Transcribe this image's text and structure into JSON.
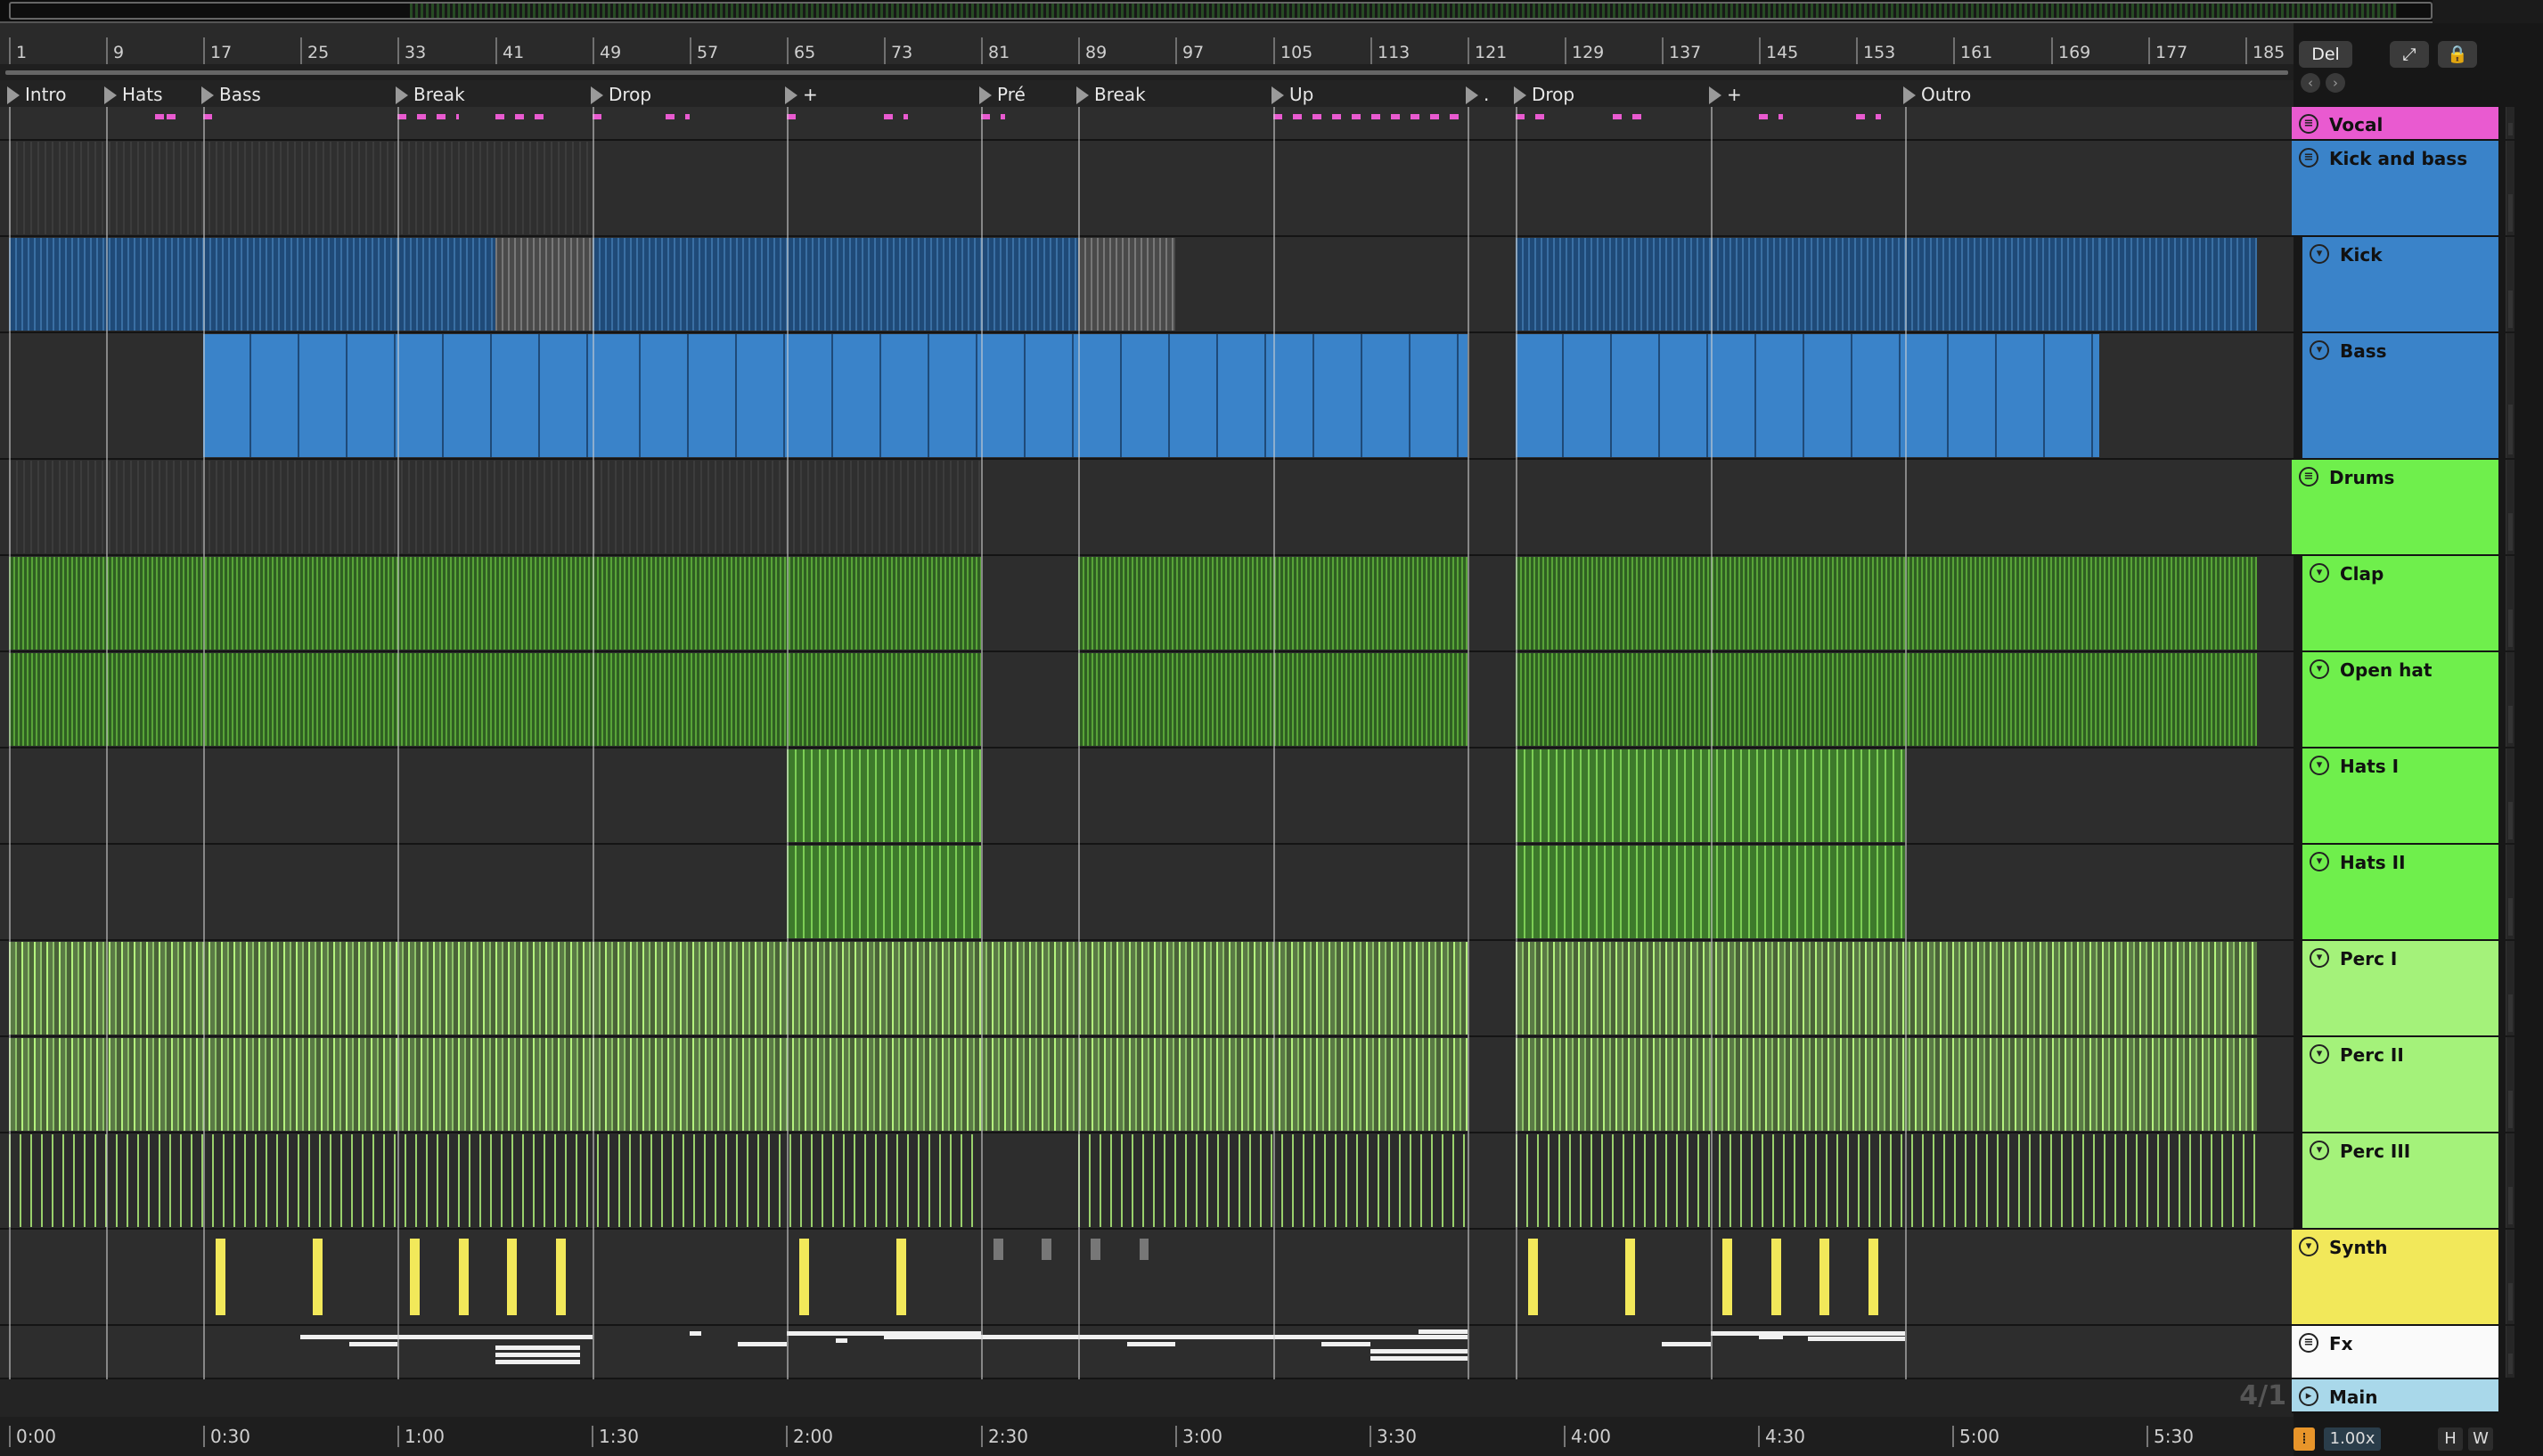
{
  "ruler": {
    "bars": [
      "1",
      "9",
      "17",
      "25",
      "33",
      "41",
      "49",
      "57",
      "65",
      "73",
      "81",
      "89",
      "97",
      "105",
      "113",
      "121",
      "129",
      "137",
      "145",
      "153",
      "161",
      "169",
      "177",
      "185"
    ]
  },
  "locators": [
    "Intro",
    "Hats",
    "Bass",
    "Break",
    "Drop",
    "+",
    "Pré",
    "Break",
    "Up",
    ".",
    "Drop",
    "+",
    "Outro"
  ],
  "time": {
    "labels": [
      "0:00",
      "0:30",
      "1:00",
      "1:30",
      "2:00",
      "2:30",
      "3:00",
      "3:30",
      "4:00",
      "4:30",
      "5:00",
      "5:30"
    ],
    "signature": "4/1"
  },
  "toolbar": {
    "del": "Del",
    "expand_icon": "expand-icon",
    "lock_icon": "lock-icon"
  },
  "tracks": [
    {
      "name": "Vocal",
      "color": "#e95ad0",
      "icon": "group-icon"
    },
    {
      "name": "Kick and bass",
      "color": "#3a83c9",
      "icon": "group-icon"
    },
    {
      "name": "Kick",
      "color": "#3a83c9",
      "icon": "fold-icon"
    },
    {
      "name": "Bass",
      "color": "#3a83c9",
      "icon": "fold-icon"
    },
    {
      "name": "Drums",
      "color": "#6fef4c",
      "icon": "group-icon"
    },
    {
      "name": "Clap",
      "color": "#6fef4c",
      "icon": "fold-icon"
    },
    {
      "name": "Open hat",
      "color": "#6fef4c",
      "icon": "fold-icon"
    },
    {
      "name": "Hats I",
      "color": "#6fef4c",
      "icon": "fold-icon"
    },
    {
      "name": "Hats II",
      "color": "#6fef4c",
      "icon": "fold-icon"
    },
    {
      "name": "Perc I",
      "color": "#a4f27a",
      "icon": "fold-icon"
    },
    {
      "name": "Perc II",
      "color": "#a4f27a",
      "icon": "fold-icon"
    },
    {
      "name": "Perc III",
      "color": "#a4f27a",
      "icon": "fold-icon"
    },
    {
      "name": "Synth",
      "color": "#f2e85a",
      "icon": "fold-icon"
    },
    {
      "name": "Fx",
      "color": "#fafafa",
      "icon": "group-icon"
    },
    {
      "name": "Main",
      "color": "#a9d8ea",
      "icon": "play-icon"
    }
  ],
  "status": {
    "tempo_factor": "1.00x",
    "h_button": "H",
    "w_button": "W"
  }
}
